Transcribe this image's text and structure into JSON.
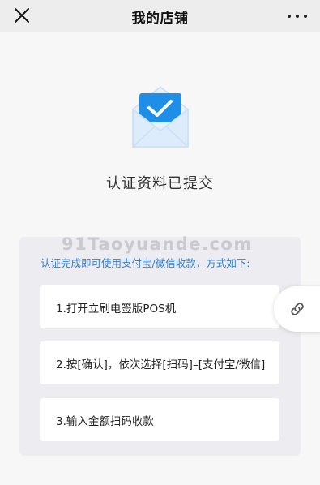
{
  "header": {
    "title": "我的店铺",
    "close_icon": "close-icon",
    "more_icon": "more-dots-icon"
  },
  "status": {
    "icon": "envelope-check-icon",
    "text": "认证资料已提交"
  },
  "watermark": "91Taoyuande.com",
  "instructions": {
    "heading": "认证完成即可使用支付宝/微信收款，方式如下:",
    "steps": [
      "1.打开立刷电签版POS机",
      "2.按[确认]，依次选择[扫码]–[支付宝/微信]",
      "3.输入金额扫码收款"
    ]
  },
  "floating_button": {
    "icon": "link-icon"
  },
  "colors": {
    "accent_blue": "#1f8ee6",
    "heading_blue": "#2f7fd8",
    "envelope_light": "#dcecfb"
  }
}
